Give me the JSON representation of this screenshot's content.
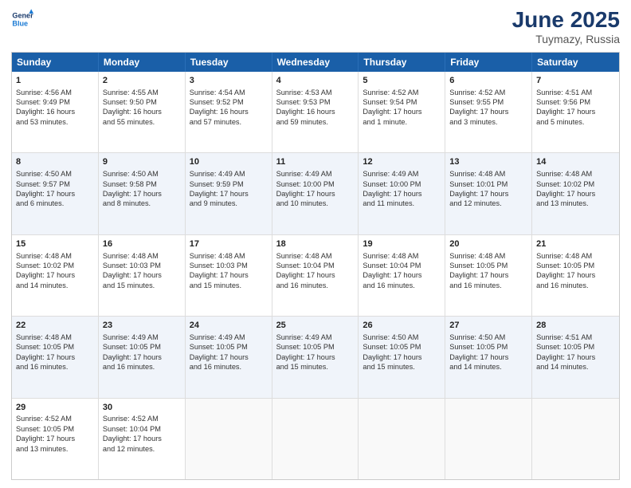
{
  "header": {
    "logo_general": "General",
    "logo_blue": "Blue",
    "title": "June 2025",
    "location": "Tuymazy, Russia"
  },
  "calendar": {
    "days_of_week": [
      "Sunday",
      "Monday",
      "Tuesday",
      "Wednesday",
      "Thursday",
      "Friday",
      "Saturday"
    ],
    "rows": [
      [
        {
          "day": "1",
          "lines": [
            "Sunrise: 4:56 AM",
            "Sunset: 9:49 PM",
            "Daylight: 16 hours",
            "and 53 minutes."
          ]
        },
        {
          "day": "2",
          "lines": [
            "Sunrise: 4:55 AM",
            "Sunset: 9:50 PM",
            "Daylight: 16 hours",
            "and 55 minutes."
          ]
        },
        {
          "day": "3",
          "lines": [
            "Sunrise: 4:54 AM",
            "Sunset: 9:52 PM",
            "Daylight: 16 hours",
            "and 57 minutes."
          ]
        },
        {
          "day": "4",
          "lines": [
            "Sunrise: 4:53 AM",
            "Sunset: 9:53 PM",
            "Daylight: 16 hours",
            "and 59 minutes."
          ]
        },
        {
          "day": "5",
          "lines": [
            "Sunrise: 4:52 AM",
            "Sunset: 9:54 PM",
            "Daylight: 17 hours",
            "and 1 minute."
          ]
        },
        {
          "day": "6",
          "lines": [
            "Sunrise: 4:52 AM",
            "Sunset: 9:55 PM",
            "Daylight: 17 hours",
            "and 3 minutes."
          ]
        },
        {
          "day": "7",
          "lines": [
            "Sunrise: 4:51 AM",
            "Sunset: 9:56 PM",
            "Daylight: 17 hours",
            "and 5 minutes."
          ]
        }
      ],
      [
        {
          "day": "8",
          "lines": [
            "Sunrise: 4:50 AM",
            "Sunset: 9:57 PM",
            "Daylight: 17 hours",
            "and 6 minutes."
          ]
        },
        {
          "day": "9",
          "lines": [
            "Sunrise: 4:50 AM",
            "Sunset: 9:58 PM",
            "Daylight: 17 hours",
            "and 8 minutes."
          ]
        },
        {
          "day": "10",
          "lines": [
            "Sunrise: 4:49 AM",
            "Sunset: 9:59 PM",
            "Daylight: 17 hours",
            "and 9 minutes."
          ]
        },
        {
          "day": "11",
          "lines": [
            "Sunrise: 4:49 AM",
            "Sunset: 10:00 PM",
            "Daylight: 17 hours",
            "and 10 minutes."
          ]
        },
        {
          "day": "12",
          "lines": [
            "Sunrise: 4:49 AM",
            "Sunset: 10:00 PM",
            "Daylight: 17 hours",
            "and 11 minutes."
          ]
        },
        {
          "day": "13",
          "lines": [
            "Sunrise: 4:48 AM",
            "Sunset: 10:01 PM",
            "Daylight: 17 hours",
            "and 12 minutes."
          ]
        },
        {
          "day": "14",
          "lines": [
            "Sunrise: 4:48 AM",
            "Sunset: 10:02 PM",
            "Daylight: 17 hours",
            "and 13 minutes."
          ]
        }
      ],
      [
        {
          "day": "15",
          "lines": [
            "Sunrise: 4:48 AM",
            "Sunset: 10:02 PM",
            "Daylight: 17 hours",
            "and 14 minutes."
          ]
        },
        {
          "day": "16",
          "lines": [
            "Sunrise: 4:48 AM",
            "Sunset: 10:03 PM",
            "Daylight: 17 hours",
            "and 15 minutes."
          ]
        },
        {
          "day": "17",
          "lines": [
            "Sunrise: 4:48 AM",
            "Sunset: 10:03 PM",
            "Daylight: 17 hours",
            "and 15 minutes."
          ]
        },
        {
          "day": "18",
          "lines": [
            "Sunrise: 4:48 AM",
            "Sunset: 10:04 PM",
            "Daylight: 17 hours",
            "and 16 minutes."
          ]
        },
        {
          "day": "19",
          "lines": [
            "Sunrise: 4:48 AM",
            "Sunset: 10:04 PM",
            "Daylight: 17 hours",
            "and 16 minutes."
          ]
        },
        {
          "day": "20",
          "lines": [
            "Sunrise: 4:48 AM",
            "Sunset: 10:05 PM",
            "Daylight: 17 hours",
            "and 16 minutes."
          ]
        },
        {
          "day": "21",
          "lines": [
            "Sunrise: 4:48 AM",
            "Sunset: 10:05 PM",
            "Daylight: 17 hours",
            "and 16 minutes."
          ]
        }
      ],
      [
        {
          "day": "22",
          "lines": [
            "Sunrise: 4:48 AM",
            "Sunset: 10:05 PM",
            "Daylight: 17 hours",
            "and 16 minutes."
          ]
        },
        {
          "day": "23",
          "lines": [
            "Sunrise: 4:49 AM",
            "Sunset: 10:05 PM",
            "Daylight: 17 hours",
            "and 16 minutes."
          ]
        },
        {
          "day": "24",
          "lines": [
            "Sunrise: 4:49 AM",
            "Sunset: 10:05 PM",
            "Daylight: 17 hours",
            "and 16 minutes."
          ]
        },
        {
          "day": "25",
          "lines": [
            "Sunrise: 4:49 AM",
            "Sunset: 10:05 PM",
            "Daylight: 17 hours",
            "and 15 minutes."
          ]
        },
        {
          "day": "26",
          "lines": [
            "Sunrise: 4:50 AM",
            "Sunset: 10:05 PM",
            "Daylight: 17 hours",
            "and 15 minutes."
          ]
        },
        {
          "day": "27",
          "lines": [
            "Sunrise: 4:50 AM",
            "Sunset: 10:05 PM",
            "Daylight: 17 hours",
            "and 14 minutes."
          ]
        },
        {
          "day": "28",
          "lines": [
            "Sunrise: 4:51 AM",
            "Sunset: 10:05 PM",
            "Daylight: 17 hours",
            "and 14 minutes."
          ]
        }
      ],
      [
        {
          "day": "29",
          "lines": [
            "Sunrise: 4:52 AM",
            "Sunset: 10:05 PM",
            "Daylight: 17 hours",
            "and 13 minutes."
          ]
        },
        {
          "day": "30",
          "lines": [
            "Sunrise: 4:52 AM",
            "Sunset: 10:04 PM",
            "Daylight: 17 hours",
            "and 12 minutes."
          ]
        },
        {
          "day": "",
          "lines": []
        },
        {
          "day": "",
          "lines": []
        },
        {
          "day": "",
          "lines": []
        },
        {
          "day": "",
          "lines": []
        },
        {
          "day": "",
          "lines": []
        }
      ]
    ]
  }
}
